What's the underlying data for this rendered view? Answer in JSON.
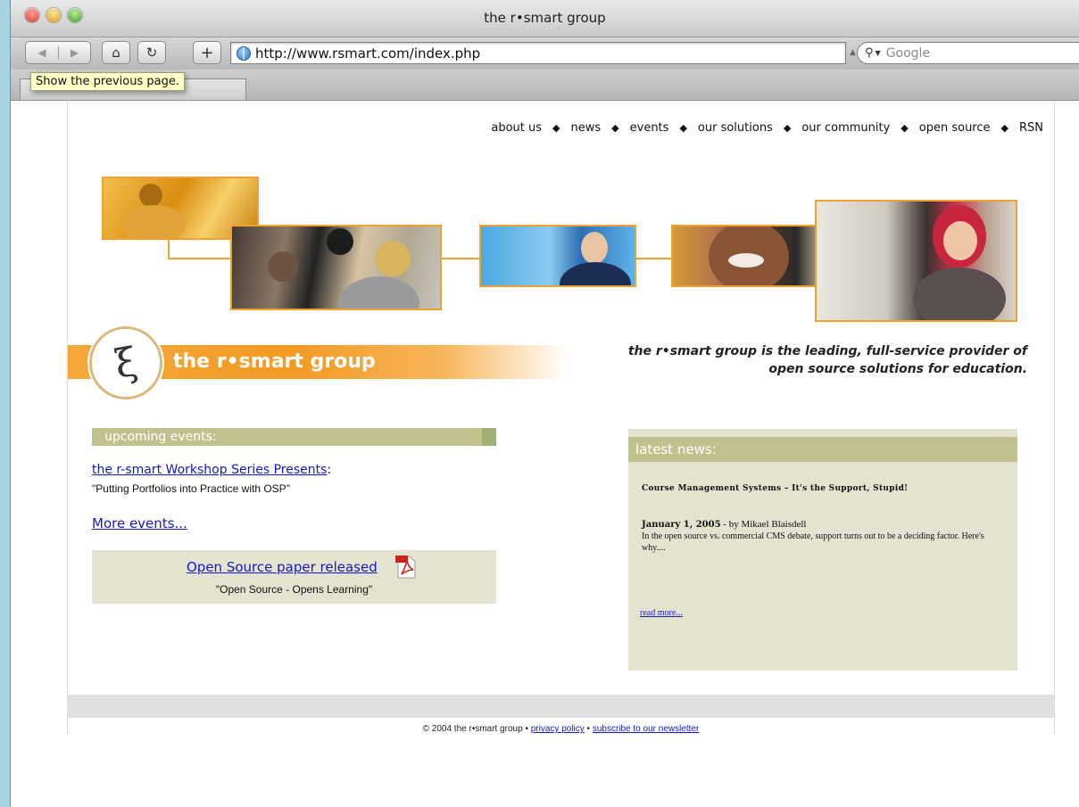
{
  "window": {
    "title": "the r•smart group"
  },
  "toolbar": {
    "back_icon": "◀",
    "forward_icon": "▶",
    "home_icon": "⌂",
    "reload_icon": "↻",
    "add_icon": "+",
    "url": "http://www.rsmart.com/index.php",
    "search_placeholder": "Google",
    "search_icon": "⚲"
  },
  "tooltip": {
    "text": "Show the previous page."
  },
  "nav": {
    "items": [
      "about us",
      "news",
      "events",
      "our solutions",
      "our community",
      "open source",
      "RSN"
    ],
    "separator": "◆"
  },
  "logo": {
    "text": "the r•smart group",
    "figure": "ξ"
  },
  "tagline": {
    "line1": "the r•smart group is the leading, full-service provider of",
    "line2": "open source solutions for education."
  },
  "events": {
    "heading": "upcoming events:",
    "link_text": "the r-smart Workshop Series Presents",
    "colon": ":",
    "subtitle": "\"Putting Portfolios into Practice with OSP\"",
    "more": "More events...",
    "paper_link": "Open Source paper released",
    "paper_subtitle": "\"Open Source - Opens Learning\""
  },
  "news": {
    "heading": "latest news:",
    "title": "Course Management Systems – It's the Support, Stupid!",
    "date": "January 1, 2005",
    "byline": " - by Mikael Blaisdell",
    "body": "In the open source vs. commercial CMS debate, support turns out to be a deciding factor. Here's why....",
    "read_more": "read more..."
  },
  "footer": {
    "copyright": "© 2004 the r•smart group • ",
    "privacy": "privacy policy",
    "dot": " • ",
    "subscribe": "subscribe to our newsletter"
  },
  "colors": {
    "accent_orange": "#f29a23",
    "olive_header": "#c2c18d",
    "panel_bg": "#e4e3d0",
    "link": "#1418c8"
  }
}
